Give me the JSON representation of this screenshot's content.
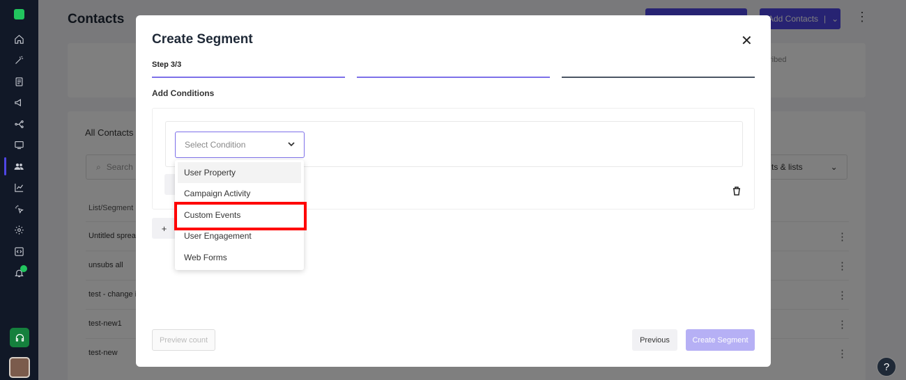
{
  "sidebar": {
    "icons": [
      "logo-icon",
      "home-icon",
      "magic-wand-icon",
      "document-icon",
      "megaphone-icon",
      "flow-icon",
      "message-icon",
      "contacts-icon",
      "chart-icon",
      "click-icon",
      "gear-icon",
      "code-icon",
      "bell-icon"
    ],
    "support_icon": "headset-icon"
  },
  "background": {
    "page_title": "Contacts",
    "add_contacts_label": "Add Contacts",
    "subscribed_text": "ribed",
    "all_contacts_label": "All Contacts",
    "search_placeholder": "Search",
    "list_filter_label": "ts & lists",
    "column_header": "List/Segment",
    "rows": [
      "Untitled sprea",
      "unsubs all",
      "test - change i",
      "test-new1",
      "test-new"
    ]
  },
  "modal": {
    "title": "Create Segment",
    "step_label": "Step 3/3",
    "section_label": "Add Conditions",
    "select_placeholder": "Select Condition",
    "add_button_symbol": "+",
    "dropdown_options": [
      "User Property",
      "Campaign Activity",
      "Custom Events",
      "User Engagement",
      "Web Forms"
    ],
    "highlighted_option": "Custom Events",
    "preview_count_label": "Preview count",
    "previous_label": "Previous",
    "create_segment_label": "Create Segment",
    "close_symbol": "✕"
  },
  "help": {
    "label": "?"
  },
  "colors": {
    "sidebar_bg": "#111827",
    "accent": "#4f46e5",
    "step_bar_active": "#7c6fe8",
    "highlight": "#ff0000"
  }
}
